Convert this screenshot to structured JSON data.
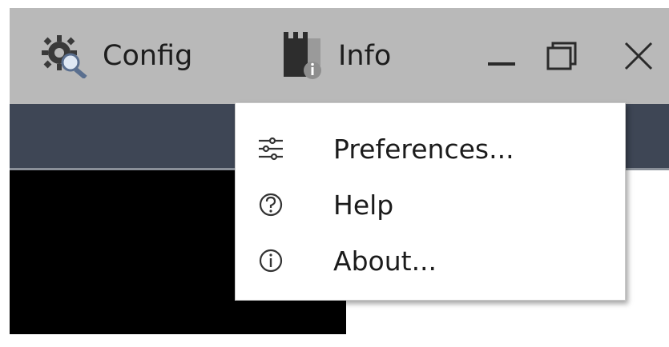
{
  "titlebar": {
    "config_label": "Config",
    "info_label": "Info",
    "icons": {
      "config": "gear-magnifier-icon",
      "info": "tower-info-icon",
      "minimize": "minimize-icon",
      "maximize": "maximize-icon",
      "close": "close-icon"
    }
  },
  "menu": {
    "items": [
      {
        "label": "Preferences...",
        "icon": "sliders-icon"
      },
      {
        "label": "Help",
        "icon": "help-circle-icon"
      },
      {
        "label": "About...",
        "icon": "info-circle-icon"
      }
    ]
  },
  "colors": {
    "titlebar_bg": "#b9b9b9",
    "subbar_bg": "#3e4655",
    "panel_bg": "#000000",
    "menu_bg": "#ffffff",
    "text": "#1b1b1b"
  }
}
